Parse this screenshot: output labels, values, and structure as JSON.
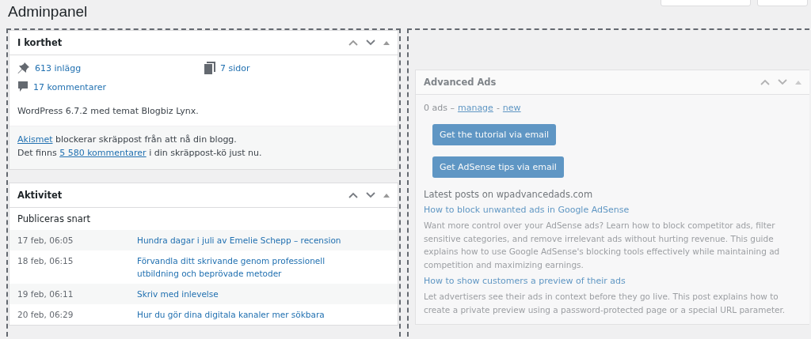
{
  "page_title": "Adminpanel",
  "top_buttons": [
    {
      "kind": "screen-options"
    },
    {
      "kind": "help"
    }
  ],
  "at_a_glance": {
    "title": "I korthet",
    "stats": [
      {
        "kind": "pin",
        "label": "613 inlägg"
      },
      {
        "kind": "pages",
        "label": "7 sidor"
      },
      {
        "kind": "comment",
        "label": "17 kommentarer"
      }
    ],
    "version_text": "WordPress 6.7.2 med temat Blogbiz Lynx.",
    "akismet_line1": {
      "link": "Akismet",
      "rest": " blockerar skräppost från att nå din blogg."
    },
    "akismet_line2": {
      "before": "Det finns ",
      "link": "5 580 kommentarer",
      "after": " i din skräppost-kö just nu."
    }
  },
  "activity": {
    "title": "Aktivitet",
    "section_title": "Publiceras snart",
    "rows": [
      {
        "date": "17 feb, 06:05",
        "title": "Hundra dagar i juli av Emelie Schepp – recension"
      },
      {
        "date": "18 feb, 06:15",
        "title": "Förvandla ditt skrivande genom professionell utbildning och beprövade metoder"
      },
      {
        "date": "19 feb, 06:11",
        "title": "Skriv med inlevelse"
      },
      {
        "date": "20 feb, 06:29",
        "title": "Hur du gör dina digitala kanaler mer sökbara"
      }
    ]
  },
  "advanced_ads": {
    "title": "Advanced Ads",
    "count_text": "0 ads –",
    "manage_link": "manage",
    "separator": "-",
    "new_link": "new",
    "buttons": [
      "Get the tutorial via email",
      "Get AdSense tips via email"
    ],
    "feed_title": "Latest posts on wpadvancedads.com",
    "posts": [
      {
        "title": "How to block unwanted ads in Google AdSense",
        "excerpt": "Want more control over your AdSense ads? Learn how to block competitor ads, filter sensitive categories, and remove irrelevant ads without hurting revenue. This guide explains how to use Google AdSense's blocking tools effectively while maintaining ad competition and maximizing earnings."
      },
      {
        "title": "How to show customers a preview of their ads",
        "excerpt": "Let advertisers see their ads in context before they go live. This post explains how to create a private preview using a password-protected page or a special URL parameter."
      }
    ]
  }
}
